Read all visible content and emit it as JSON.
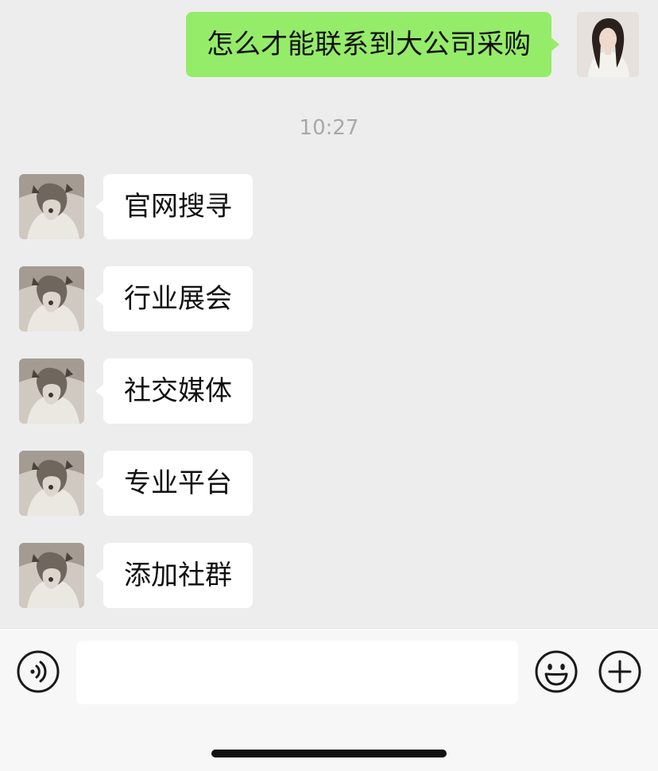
{
  "conversation": {
    "outgoing_message": "怎么才能联系到大公司采购",
    "timestamp": "10:27",
    "incoming_messages": [
      {
        "text": "官网搜寻"
      },
      {
        "text": "行业展会"
      },
      {
        "text": "社交媒体"
      },
      {
        "text": "专业平台"
      },
      {
        "text": "添加社群"
      }
    ]
  },
  "input_bar": {
    "left_icon": "voice-icon",
    "emoji_icon": "emoji-icon",
    "plus_icon": "plus-icon",
    "text_value": ""
  },
  "colors": {
    "background": "#ededed",
    "outgoing_bubble": "#95ec69",
    "incoming_bubble": "#ffffff",
    "timestamp_text": "#a8a8a8"
  }
}
